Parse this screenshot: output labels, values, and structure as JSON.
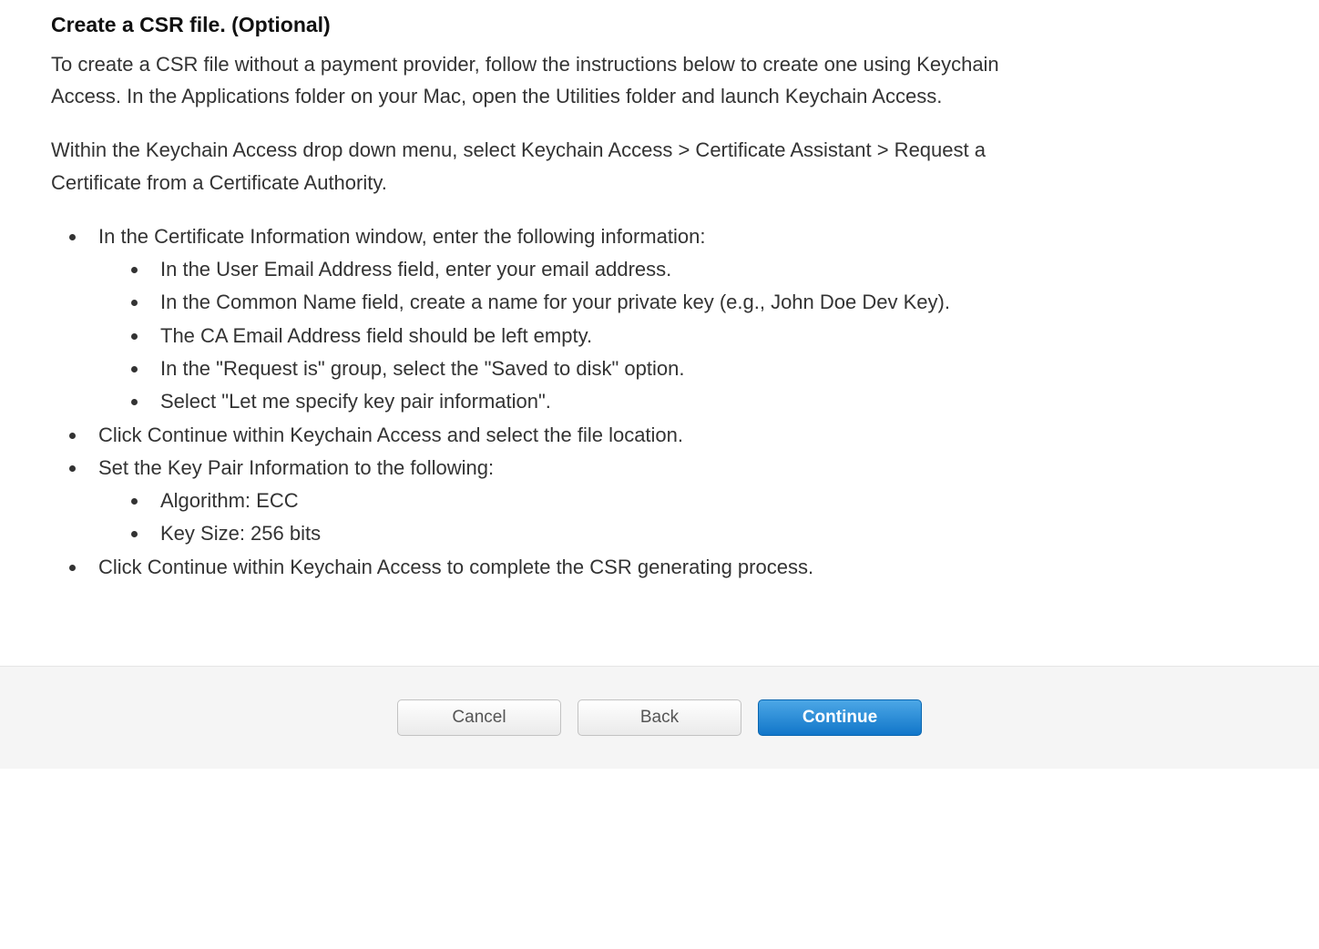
{
  "heading": "Create a CSR file. (Optional)",
  "para1": "To create a CSR file without a payment provider, follow the instructions below to create one using Keychain Access. In the Applications folder on your Mac, open the Utilities folder and launch Keychain Access.",
  "para2": "Within the Keychain Access drop down menu, select Keychain Access > Certificate Assistant > Request a Certificate from a Certificate Authority.",
  "list": {
    "item1": "In the Certificate Information window, enter the following information:",
    "item1_sub": [
      "In the User Email Address field, enter your email address.",
      "In the Common Name field, create a name for your private key (e.g., John Doe Dev Key).",
      "The CA Email Address field should be left empty.",
      "In the \"Request is\" group, select the \"Saved to disk\" option.",
      "Select \"Let me specify key pair information\"."
    ],
    "item2": "Click Continue within Keychain Access and select the file location.",
    "item3": "Set the Key Pair Information to the following:",
    "item3_sub": [
      "Algorithm: ECC",
      "Key Size: 256 bits"
    ],
    "item4": "Click Continue within Keychain Access to complete the CSR generating process."
  },
  "buttons": {
    "cancel": "Cancel",
    "back": "Back",
    "continue": "Continue"
  }
}
